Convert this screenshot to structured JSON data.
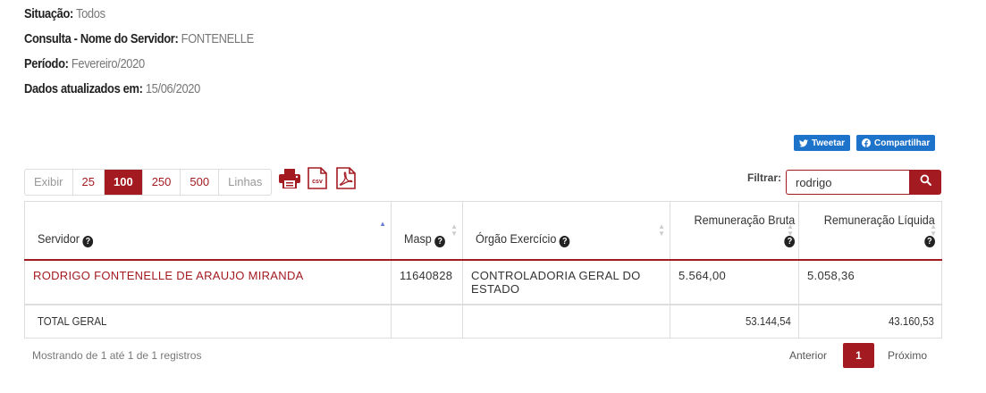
{
  "info": [
    {
      "key": "Situação:",
      "value": "Todos"
    },
    {
      "key": "Consulta - Nome do Servidor:",
      "value": "FONTENELLE"
    },
    {
      "key": "Período:",
      "value": "Fevereiro/2020"
    },
    {
      "key": "Dados atualizados em:",
      "value": "15/06/2020"
    }
  ],
  "share": {
    "tweet": "Tweetar",
    "facebook": "Compartilhar"
  },
  "length_menu": {
    "prefix": "Exibir",
    "options": [
      "25",
      "100",
      "250",
      "500"
    ],
    "selected": "100",
    "suffix": "Linhas"
  },
  "export": {
    "csv": "csv"
  },
  "filter": {
    "label": "Filtrar:",
    "value": "rodrigo"
  },
  "table": {
    "headers": {
      "servidor": "Servidor",
      "masp": "Masp",
      "orgao": "Órgão Exercício",
      "bruta": "Remuneração Bruta",
      "liquida": "Remuneração Líquida"
    },
    "rows": [
      {
        "servidor": "RODRIGO FONTENELLE DE ARAUJO MIRANDA",
        "masp": "11640828",
        "orgao": "CONTROLADORIA GERAL DO ESTADO",
        "bruta": "5.564,00",
        "liquida": "5.058,36"
      }
    ],
    "total": {
      "label": "TOTAL GERAL",
      "bruta": "53.144,54",
      "liquida": "43.160,53"
    }
  },
  "footer": {
    "info": "Mostrando de 1 até 1 de 1 registros",
    "prev": "Anterior",
    "current": "1",
    "next": "Próximo"
  },
  "colors": {
    "accent": "#a31b21",
    "share": "#1d72c9"
  },
  "icons": [
    "twitter-icon",
    "facebook-icon",
    "print-icon",
    "csv-icon",
    "pdf-icon",
    "search-icon",
    "help-icon",
    "sort-icon"
  ]
}
